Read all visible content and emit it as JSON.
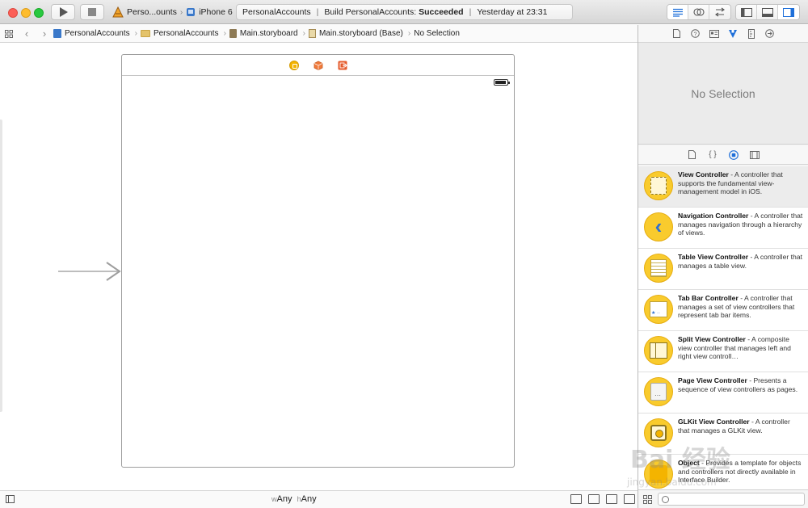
{
  "toolbar": {
    "scheme_target": "Perso...ounts",
    "scheme_sep": "›",
    "scheme_device": "iPhone 6",
    "status_project": "PersonalAccounts",
    "status_build_prefix": "Build PersonalAccounts:",
    "status_build_result": "Succeeded",
    "status_time": "Yesterday at 23:31"
  },
  "jumpbar": {
    "crumbs": [
      "PersonalAccounts",
      "PersonalAccounts",
      "Main.storyboard",
      "Main.storyboard (Base)",
      "No Selection"
    ]
  },
  "bottombar": {
    "w_label": "w",
    "w_value": "Any",
    "h_label": "h",
    "h_value": "Any"
  },
  "inspector": {
    "no_selection": "No Selection"
  },
  "library": {
    "items": [
      {
        "title": "View Controller",
        "desc": " - A controller that supports the fundamental view-management model in iOS.",
        "icon": "view-controller-icon"
      },
      {
        "title": "Navigation Controller",
        "desc": " - A controller that manages navigation through a hierarchy of views.",
        "icon": "navigation-controller-icon"
      },
      {
        "title": "Table View Controller",
        "desc": " - A controller that manages a table view.",
        "icon": "table-view-controller-icon"
      },
      {
        "title": "Tab Bar Controller",
        "desc": " - A controller that manages a set of view controllers that represent tab bar items.",
        "icon": "tab-bar-controller-icon"
      },
      {
        "title": "Split View Controller",
        "desc": " - A composite view controller that manages left and right view controll…",
        "icon": "split-view-controller-icon"
      },
      {
        "title": "Page View Controller",
        "desc": " - Presents a sequence of view controllers as pages.",
        "icon": "page-view-controller-icon"
      },
      {
        "title": "GLKit View Controller",
        "desc": " - A controller that manages a GLKit view.",
        "icon": "glkit-view-controller-icon"
      },
      {
        "title": "Object",
        "desc": " - Provides a template for objects and controllers not directly available in Interface Builder.",
        "icon": "object-icon"
      }
    ]
  },
  "watermark": {
    "text": "Bai 经验",
    "url": "jingyan.baidu.com"
  },
  "colors": {
    "accent": "#1e6fd9",
    "library_icon_yellow": "#f9cb2d",
    "close": "#fc5f57",
    "minimize": "#fdbc2e",
    "maximize": "#28c840"
  }
}
